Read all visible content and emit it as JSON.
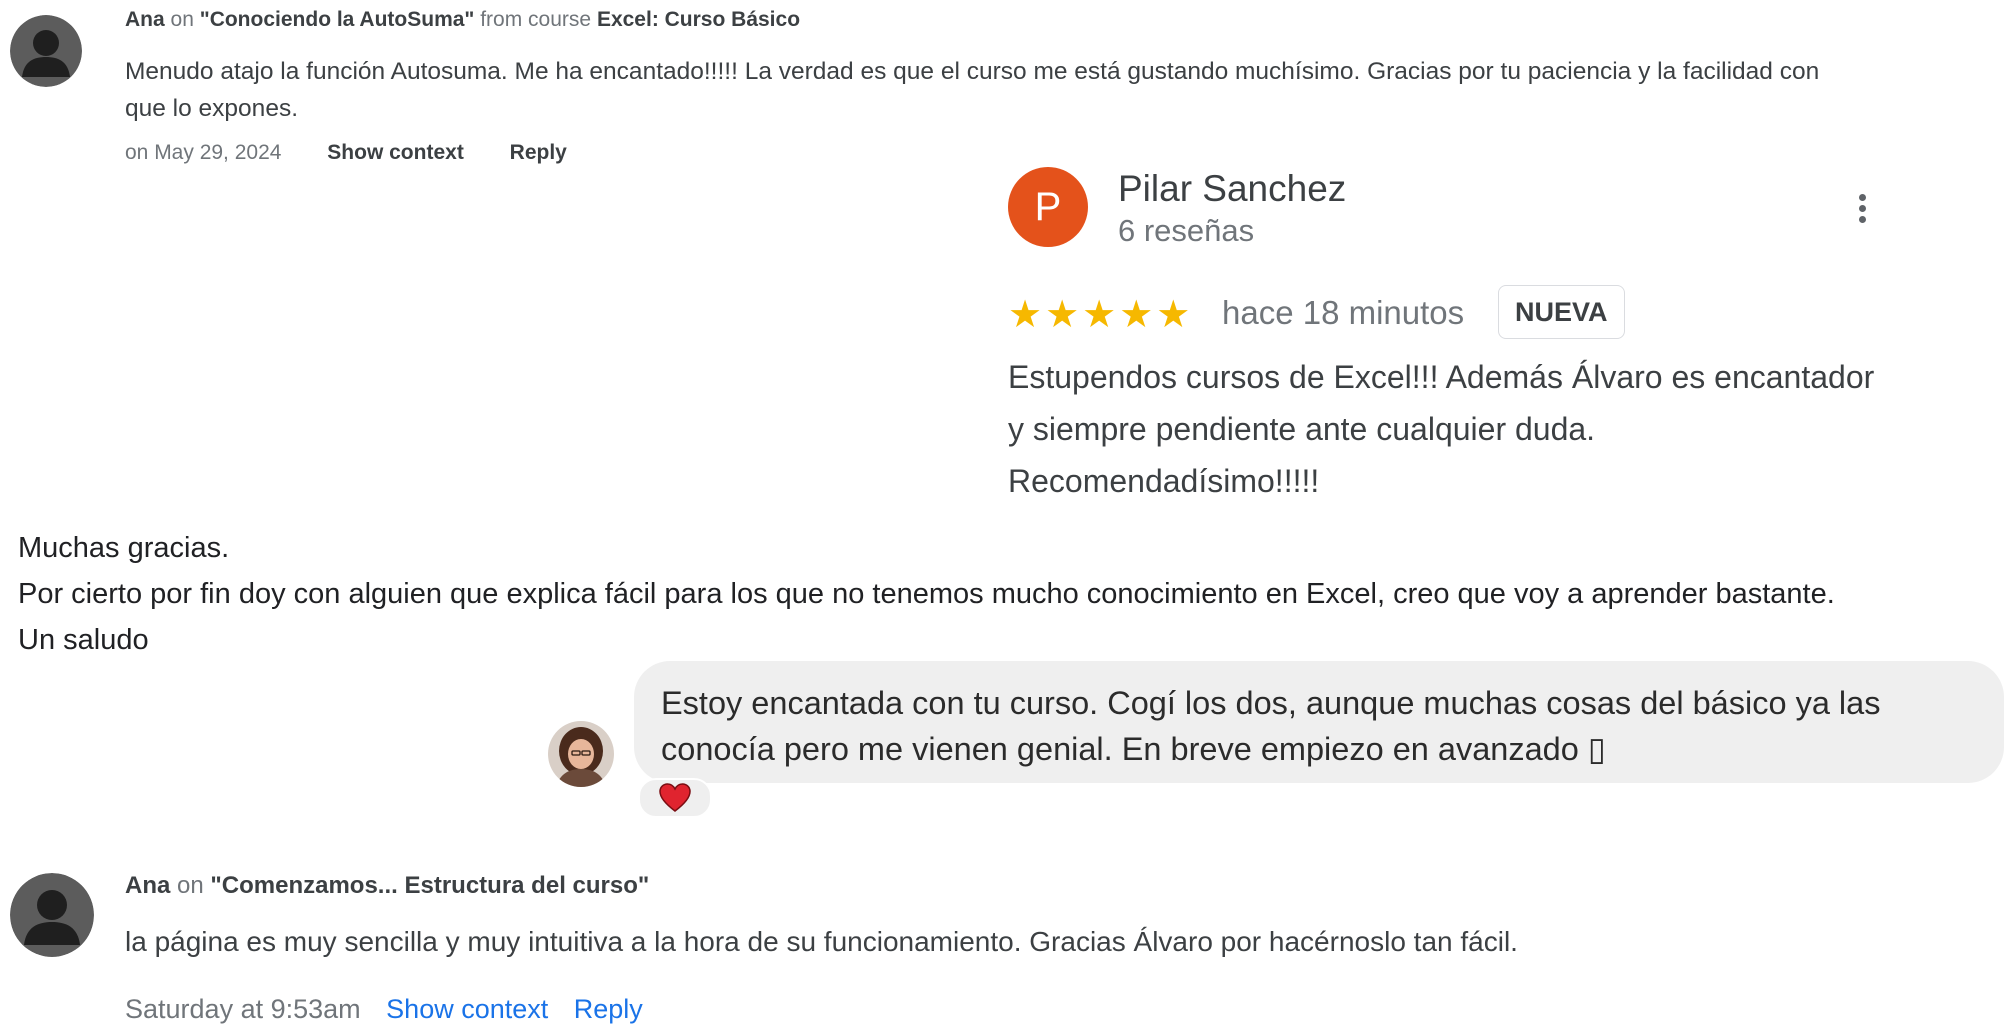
{
  "comment1": {
    "author": "Ana",
    "on_word": "on",
    "lesson": "\"Conociendo la AutoSuma\"",
    "from_word": "from course",
    "course": "Excel: Curso Básico",
    "body": "Menudo atajo la función Autosuma. Me ha encantado!!!!! La verdad es que el curso me está gustando muchísimo. Gracias por tu paciencia y la facilidad con que lo expones.",
    "date": "on May 29, 2024",
    "show_context": "Show context",
    "reply": "Reply"
  },
  "review": {
    "avatar_letter": "P",
    "avatar_color": "#e4521b",
    "name": "Pilar Sanchez",
    "count": "6 reseñas",
    "stars": "★★★★★",
    "rating": 5,
    "time": "hace 18 minutos",
    "badge": "NUEVA",
    "text": "Estupendos cursos de Excel!!! Además Álvaro es encantador y siempre pendiente ante cualquier duda. Recomendadísimo!!!!!"
  },
  "email": {
    "line1": "Muchas gracias.",
    "line2": "Por cierto por fin doy con alguien que explica fácil para los que no tenemos mucho conocimiento en Excel, creo que voy a aprender bastante.",
    "line3": "Un saludo"
  },
  "chat": {
    "text": "Estoy encantada con tu curso. Cogí los dos, aunque muchas cosas del básico ya las conocía pero me vienen genial. En breve empiezo en avanzado ▯",
    "reaction": "heart-icon"
  },
  "comment2": {
    "author": "Ana",
    "on_word": "on",
    "lesson": "\"Comenzamos... Estructura del curso\"",
    "body": "la página es muy sencilla y muy intuitiva a la hora de su funcionamiento. Gracias Álvaro por hacérnoslo tan fácil.",
    "date": "Saturday at 9:53am",
    "show_context": "Show context",
    "reply": "Reply"
  }
}
